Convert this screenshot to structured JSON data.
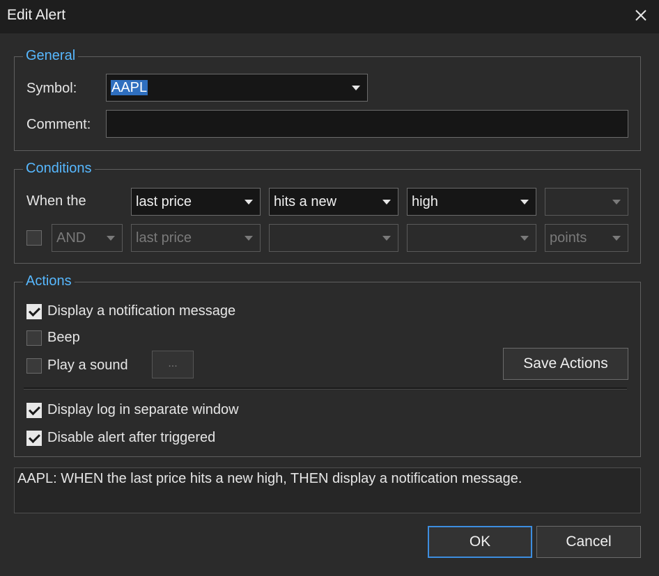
{
  "window": {
    "title": "Edit Alert"
  },
  "general": {
    "legend": "General",
    "symbol_label": "Symbol:",
    "symbol_value": "AAPL",
    "comment_label": "Comment:",
    "comment_value": ""
  },
  "conditions": {
    "legend": "Conditions",
    "when_label": "When the",
    "row1": {
      "field": "last price",
      "operator": "hits a new",
      "target": "high",
      "extra": ""
    },
    "row2": {
      "checked": false,
      "conjunction": "AND",
      "field": "last price",
      "operator": "",
      "target": "",
      "unit": "points"
    }
  },
  "actions": {
    "legend": "Actions",
    "notify": {
      "label": "Display a notification message",
      "checked": true
    },
    "beep": {
      "label": "Beep",
      "checked": false
    },
    "sound": {
      "label": "Play a sound",
      "checked": false,
      "browse_label": "..."
    },
    "save_label": "Save Actions",
    "log": {
      "label": "Display log in separate window",
      "checked": true
    },
    "disable": {
      "label": "Disable alert after triggered",
      "checked": true
    }
  },
  "summary": "AAPL:  WHEN the last price hits a new high, THEN display a notification message.",
  "buttons": {
    "ok": "OK",
    "cancel": "Cancel"
  },
  "colors": {
    "accent": "#57b8ff",
    "default_button_border": "#3d8ee0"
  }
}
